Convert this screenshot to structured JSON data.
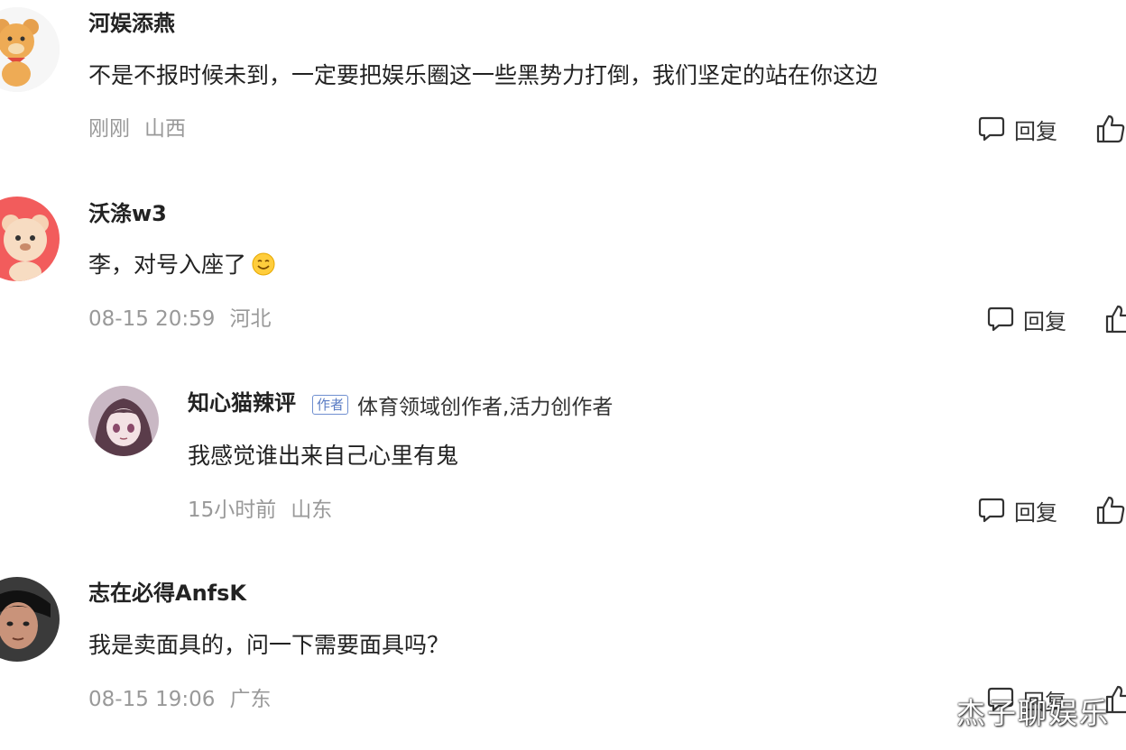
{
  "comments": [
    {
      "username": "河娱添燕",
      "text": "不是不报时候未到，一定要把娱乐圈这一些黑势力打倒，我们坚定的站在你这边",
      "time": "刚刚",
      "location": "山西",
      "reply_label": "回复"
    },
    {
      "username": "沃涤w3",
      "text": "李，对号入座了",
      "time": "08-15 20:59",
      "location": "河北",
      "reply_label": "回复"
    },
    {
      "username": "知心猫辣评",
      "badge": "作者",
      "badge_desc": "体育领域创作者,活力创作者",
      "text": "我感觉谁出来自己心里有鬼",
      "time": "15小时前",
      "location": "山东",
      "reply_label": "回复"
    },
    {
      "username": "志在必得AnfsK",
      "text": "我是卖面具的，问一下需要面具吗？",
      "time": "08-15 19:06",
      "location": "广东",
      "reply_label": "回复"
    }
  ],
  "watermark": "杰子聊娱乐",
  "colors": {
    "meta_gray": "#999999",
    "badge_blue": "#5a7cc4",
    "text_dark": "#222222"
  }
}
